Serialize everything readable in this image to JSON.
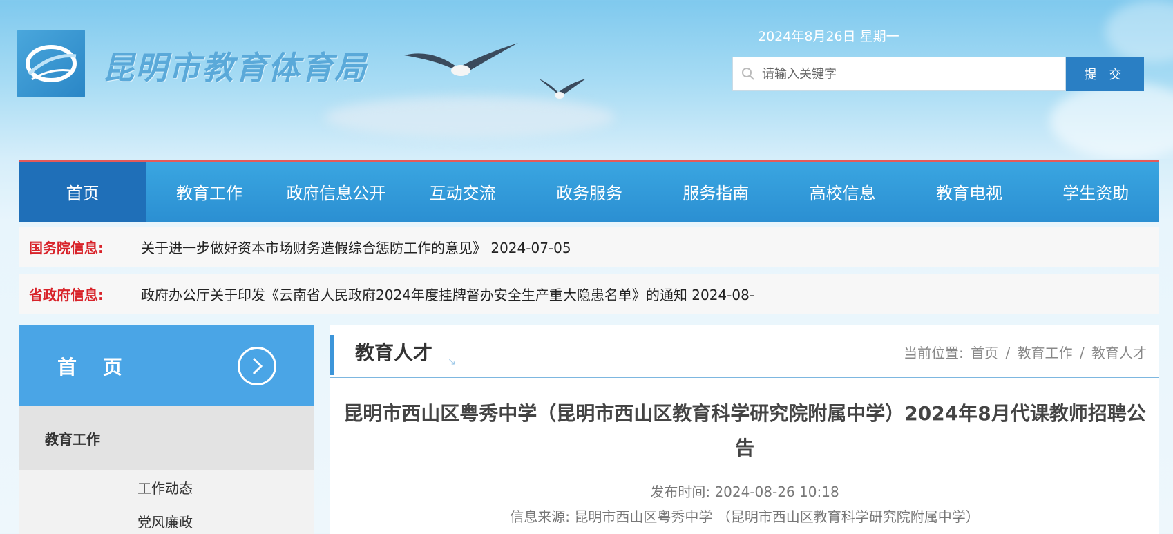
{
  "header": {
    "logo_text": "昆明市教育体育局",
    "date": "2024年8月26日 星期一",
    "search": {
      "placeholder": "请输入关键字",
      "submit_label": "提 交"
    }
  },
  "nav": {
    "items": [
      {
        "label": "首页"
      },
      {
        "label": "教育工作"
      },
      {
        "label": "政府信息公开"
      },
      {
        "label": "互动交流"
      },
      {
        "label": "政务服务"
      },
      {
        "label": "服务指南"
      },
      {
        "label": "高校信息"
      },
      {
        "label": "教育电视"
      },
      {
        "label": "学生资助"
      }
    ]
  },
  "tickers": [
    {
      "label": "国务院信息:",
      "text": "关于进一步做好资本市场财务造假综合惩防工作的意见》 2024-07-05"
    },
    {
      "label": "省政府信息:",
      "text": "政府办公厅关于印发《云南省人民政府2024年度挂牌督办安全生产重大隐患名单》的通知 2024-08-"
    }
  ],
  "sidebar": {
    "home_label": "首 页",
    "section_label": "教育工作",
    "sub_items": [
      {
        "label": "工作动态"
      },
      {
        "label": "党风廉政"
      }
    ]
  },
  "main": {
    "category": "教育人才",
    "breadcrumb": {
      "prefix": "当前位置:",
      "items": [
        "首页",
        "教育工作",
        "教育人才"
      ],
      "separator": "/"
    },
    "article": {
      "title": "昆明市西山区粤秀中学（昆明市西山区教育科学研究院附属中学）2024年8月代课教师招聘公告",
      "publish_label": "发布时间:",
      "publish_time": "2024-08-26 10:18",
      "source_label": "信息来源:",
      "source": "昆明市西山区粤秀中学 （昆明市西山区教育科学研究院附属中学）"
    }
  },
  "colors": {
    "nav_bg": "#2b8fd2",
    "nav_active": "#1f6fb8",
    "ticker_label": "#d8232a",
    "sidebar_home": "#4aa5e6"
  }
}
